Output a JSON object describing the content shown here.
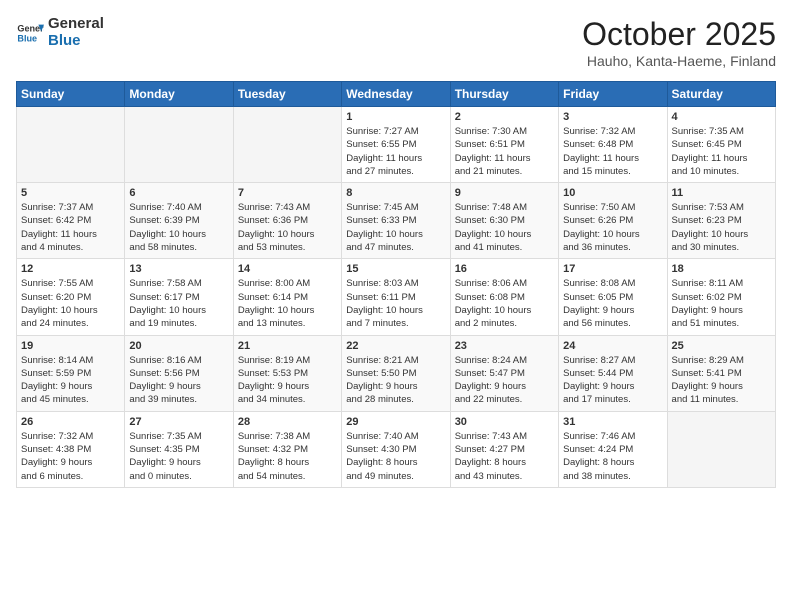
{
  "header": {
    "logo_general": "General",
    "logo_blue": "Blue",
    "month": "October 2025",
    "location": "Hauho, Kanta-Haeme, Finland"
  },
  "weekdays": [
    "Sunday",
    "Monday",
    "Tuesday",
    "Wednesday",
    "Thursday",
    "Friday",
    "Saturday"
  ],
  "weeks": [
    [
      {
        "day": "",
        "info": ""
      },
      {
        "day": "",
        "info": ""
      },
      {
        "day": "",
        "info": ""
      },
      {
        "day": "1",
        "info": "Sunrise: 7:27 AM\nSunset: 6:55 PM\nDaylight: 11 hours\nand 27 minutes."
      },
      {
        "day": "2",
        "info": "Sunrise: 7:30 AM\nSunset: 6:51 PM\nDaylight: 11 hours\nand 21 minutes."
      },
      {
        "day": "3",
        "info": "Sunrise: 7:32 AM\nSunset: 6:48 PM\nDaylight: 11 hours\nand 15 minutes."
      },
      {
        "day": "4",
        "info": "Sunrise: 7:35 AM\nSunset: 6:45 PM\nDaylight: 11 hours\nand 10 minutes."
      }
    ],
    [
      {
        "day": "5",
        "info": "Sunrise: 7:37 AM\nSunset: 6:42 PM\nDaylight: 11 hours\nand 4 minutes."
      },
      {
        "day": "6",
        "info": "Sunrise: 7:40 AM\nSunset: 6:39 PM\nDaylight: 10 hours\nand 58 minutes."
      },
      {
        "day": "7",
        "info": "Sunrise: 7:43 AM\nSunset: 6:36 PM\nDaylight: 10 hours\nand 53 minutes."
      },
      {
        "day": "8",
        "info": "Sunrise: 7:45 AM\nSunset: 6:33 PM\nDaylight: 10 hours\nand 47 minutes."
      },
      {
        "day": "9",
        "info": "Sunrise: 7:48 AM\nSunset: 6:30 PM\nDaylight: 10 hours\nand 41 minutes."
      },
      {
        "day": "10",
        "info": "Sunrise: 7:50 AM\nSunset: 6:26 PM\nDaylight: 10 hours\nand 36 minutes."
      },
      {
        "day": "11",
        "info": "Sunrise: 7:53 AM\nSunset: 6:23 PM\nDaylight: 10 hours\nand 30 minutes."
      }
    ],
    [
      {
        "day": "12",
        "info": "Sunrise: 7:55 AM\nSunset: 6:20 PM\nDaylight: 10 hours\nand 24 minutes."
      },
      {
        "day": "13",
        "info": "Sunrise: 7:58 AM\nSunset: 6:17 PM\nDaylight: 10 hours\nand 19 minutes."
      },
      {
        "day": "14",
        "info": "Sunrise: 8:00 AM\nSunset: 6:14 PM\nDaylight: 10 hours\nand 13 minutes."
      },
      {
        "day": "15",
        "info": "Sunrise: 8:03 AM\nSunset: 6:11 PM\nDaylight: 10 hours\nand 7 minutes."
      },
      {
        "day": "16",
        "info": "Sunrise: 8:06 AM\nSunset: 6:08 PM\nDaylight: 10 hours\nand 2 minutes."
      },
      {
        "day": "17",
        "info": "Sunrise: 8:08 AM\nSunset: 6:05 PM\nDaylight: 9 hours\nand 56 minutes."
      },
      {
        "day": "18",
        "info": "Sunrise: 8:11 AM\nSunset: 6:02 PM\nDaylight: 9 hours\nand 51 minutes."
      }
    ],
    [
      {
        "day": "19",
        "info": "Sunrise: 8:14 AM\nSunset: 5:59 PM\nDaylight: 9 hours\nand 45 minutes."
      },
      {
        "day": "20",
        "info": "Sunrise: 8:16 AM\nSunset: 5:56 PM\nDaylight: 9 hours\nand 39 minutes."
      },
      {
        "day": "21",
        "info": "Sunrise: 8:19 AM\nSunset: 5:53 PM\nDaylight: 9 hours\nand 34 minutes."
      },
      {
        "day": "22",
        "info": "Sunrise: 8:21 AM\nSunset: 5:50 PM\nDaylight: 9 hours\nand 28 minutes."
      },
      {
        "day": "23",
        "info": "Sunrise: 8:24 AM\nSunset: 5:47 PM\nDaylight: 9 hours\nand 22 minutes."
      },
      {
        "day": "24",
        "info": "Sunrise: 8:27 AM\nSunset: 5:44 PM\nDaylight: 9 hours\nand 17 minutes."
      },
      {
        "day": "25",
        "info": "Sunrise: 8:29 AM\nSunset: 5:41 PM\nDaylight: 9 hours\nand 11 minutes."
      }
    ],
    [
      {
        "day": "26",
        "info": "Sunrise: 7:32 AM\nSunset: 4:38 PM\nDaylight: 9 hours\nand 6 minutes."
      },
      {
        "day": "27",
        "info": "Sunrise: 7:35 AM\nSunset: 4:35 PM\nDaylight: 9 hours\nand 0 minutes."
      },
      {
        "day": "28",
        "info": "Sunrise: 7:38 AM\nSunset: 4:32 PM\nDaylight: 8 hours\nand 54 minutes."
      },
      {
        "day": "29",
        "info": "Sunrise: 7:40 AM\nSunset: 4:30 PM\nDaylight: 8 hours\nand 49 minutes."
      },
      {
        "day": "30",
        "info": "Sunrise: 7:43 AM\nSunset: 4:27 PM\nDaylight: 8 hours\nand 43 minutes."
      },
      {
        "day": "31",
        "info": "Sunrise: 7:46 AM\nSunset: 4:24 PM\nDaylight: 8 hours\nand 38 minutes."
      },
      {
        "day": "",
        "info": ""
      }
    ]
  ]
}
